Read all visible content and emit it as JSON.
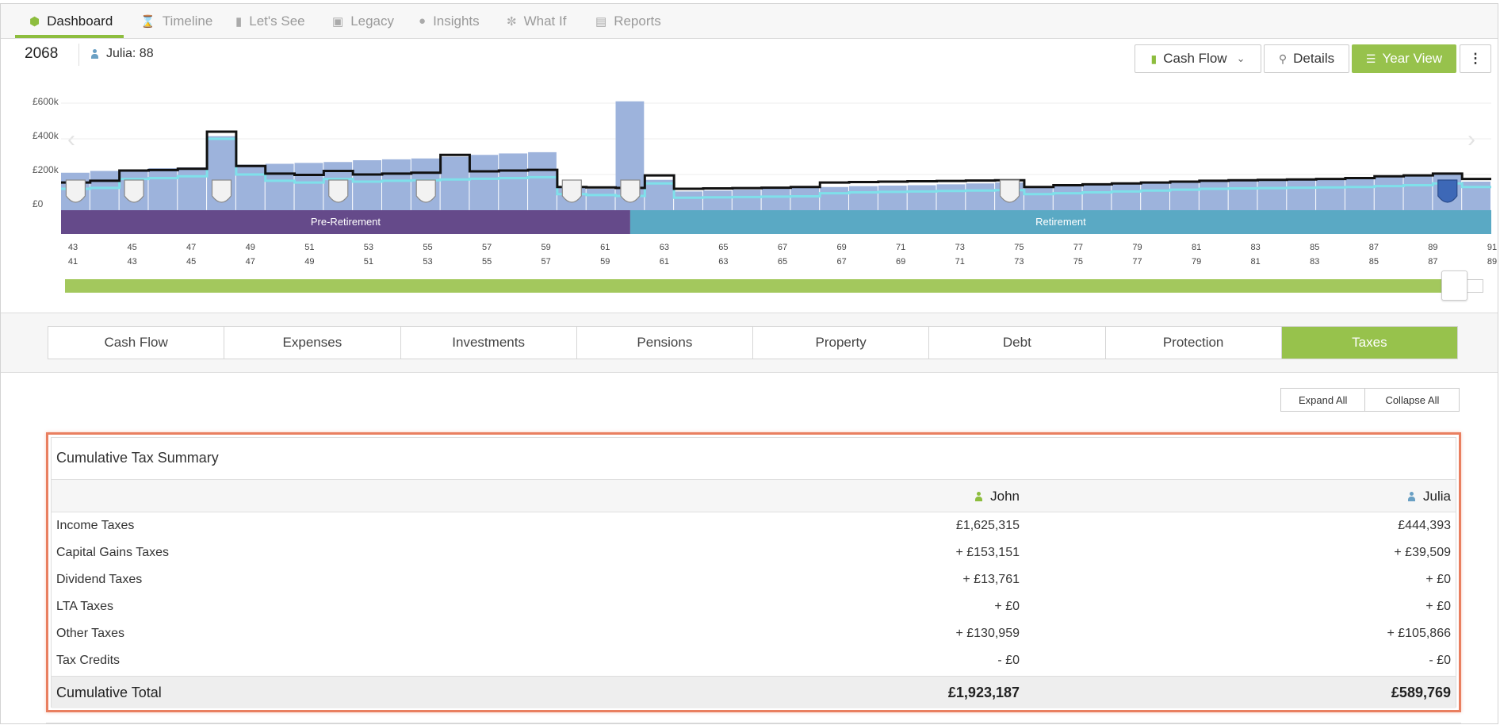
{
  "nav": {
    "items": [
      {
        "label": "Dashboard",
        "icon": "cube-icon",
        "active": true
      },
      {
        "label": "Timeline",
        "icon": "hourglass-icon"
      },
      {
        "label": "Let's See",
        "icon": "bar-chart-icon"
      },
      {
        "label": "Legacy",
        "icon": "gift-icon"
      },
      {
        "label": "Insights",
        "icon": "lightbulb-icon"
      },
      {
        "label": "What If",
        "icon": "brain-icon"
      },
      {
        "label": "Reports",
        "icon": "pdf-icon"
      }
    ]
  },
  "topbar": {
    "year": "2068",
    "person_age": "Julia: 88",
    "cashflow_label": "Cash Flow",
    "details_label": "Details",
    "yearview_label": "Year View",
    "more_icon": "vertical-dots-icon"
  },
  "chart_data": {
    "type": "bar",
    "y_tick_labels": [
      "£600k",
      "£400k",
      "£200k",
      "£0"
    ],
    "ylim": [
      0,
      600000
    ],
    "phases": [
      {
        "label": "Pre-Retirement",
        "color": "#654a8a"
      },
      {
        "label": "Retirement",
        "color": "#5aa9c4"
      }
    ],
    "john_ages": [
      43,
      45,
      47,
      49,
      51,
      53,
      55,
      57,
      59,
      61,
      63,
      65,
      67,
      69,
      71,
      73,
      75,
      77,
      79,
      81,
      83,
      85,
      87,
      89,
      91
    ],
    "julia_ages": [
      41,
      43,
      45,
      47,
      49,
      51,
      53,
      55,
      57,
      59,
      61,
      63,
      65,
      67,
      69,
      71,
      73,
      75,
      77,
      79,
      81,
      83,
      85,
      87,
      89
    ],
    "series": [
      {
        "name": "Bars",
        "color": "#9db3dc",
        "values": [
          210000,
          220000,
          225000,
          235000,
          240000,
          415000,
          255000,
          260000,
          265000,
          270000,
          280000,
          285000,
          290000,
          300000,
          310000,
          318000,
          325000,
          125000,
          120000,
          610000,
          170000,
          105000,
          110000,
          115000,
          120000,
          125000,
          130000,
          135000,
          138000,
          140000,
          145000,
          150000,
          155000,
          135000,
          138000,
          142000,
          146000,
          150000,
          155000,
          160000,
          165000,
          170000,
          175000,
          180000,
          185000,
          190000,
          195000,
          200000,
          160000
        ]
      },
      {
        "name": "Line",
        "color": "#111111",
        "values": [
          155000,
          165000,
          222000,
          225000,
          232000,
          440000,
          248000,
          205000,
          198000,
          220000,
          200000,
          205000,
          210000,
          310000,
          218000,
          222000,
          226000,
          130000,
          128000,
          125000,
          195000,
          120000,
          122000,
          124000,
          126000,
          130000,
          155000,
          158000,
          160000,
          162000,
          164000,
          166000,
          168000,
          130000,
          140000,
          145000,
          150000,
          155000,
          160000,
          165000,
          168000,
          170000,
          172000,
          175000,
          180000,
          190000,
          195000,
          205000,
          175000
        ]
      },
      {
        "name": "Lower line",
        "color": "#7fe0ea",
        "values": [
          120000,
          125000,
          175000,
          180000,
          190000,
          400000,
          200000,
          165000,
          155000,
          175000,
          160000,
          165000,
          168000,
          172000,
          176000,
          180000,
          185000,
          90000,
          85000,
          80000,
          150000,
          70000,
          72000,
          74000,
          76000,
          78000,
          95000,
          100000,
          103000,
          105000,
          108000,
          110000,
          112000,
          90000,
          95000,
          100000,
          105000,
          110000,
          115000,
          120000,
          122000,
          124000,
          126000,
          128000,
          130000,
          135000,
          140000,
          150000,
          130000
        ]
      }
    ],
    "event_marker_indices": [
      0,
      2,
      5,
      9,
      12,
      17,
      19,
      32,
      47
    ]
  },
  "tabs": [
    {
      "label": "Cash Flow"
    },
    {
      "label": "Expenses"
    },
    {
      "label": "Investments"
    },
    {
      "label": "Pensions"
    },
    {
      "label": "Property"
    },
    {
      "label": "Debt"
    },
    {
      "label": "Protection"
    },
    {
      "label": "Taxes",
      "active": true
    }
  ],
  "actions": {
    "expand_all": "Expand All",
    "collapse_all": "Collapse All"
  },
  "tax_summary": {
    "title": "Cumulative Tax Summary",
    "col_john": "John",
    "col_julia": "Julia",
    "rows": [
      {
        "label": "Income Taxes",
        "john": "£1,625,315",
        "julia": "£444,393"
      },
      {
        "label": "Capital Gains Taxes",
        "john": "+ £153,151",
        "julia": "+ £39,509"
      },
      {
        "label": "Dividend Taxes",
        "john": "+ £13,761",
        "julia": "+ £0"
      },
      {
        "label": "LTA Taxes",
        "john": "+ £0",
        "julia": "+ £0"
      },
      {
        "label": "Other Taxes",
        "john": "+ £130,959",
        "julia": "+ £105,866"
      },
      {
        "label": "Tax Credits",
        "john": "- £0",
        "julia": "- £0"
      }
    ],
    "total": {
      "label": "Cumulative Total",
      "john": "£1,923,187",
      "julia": "£589,769"
    }
  }
}
